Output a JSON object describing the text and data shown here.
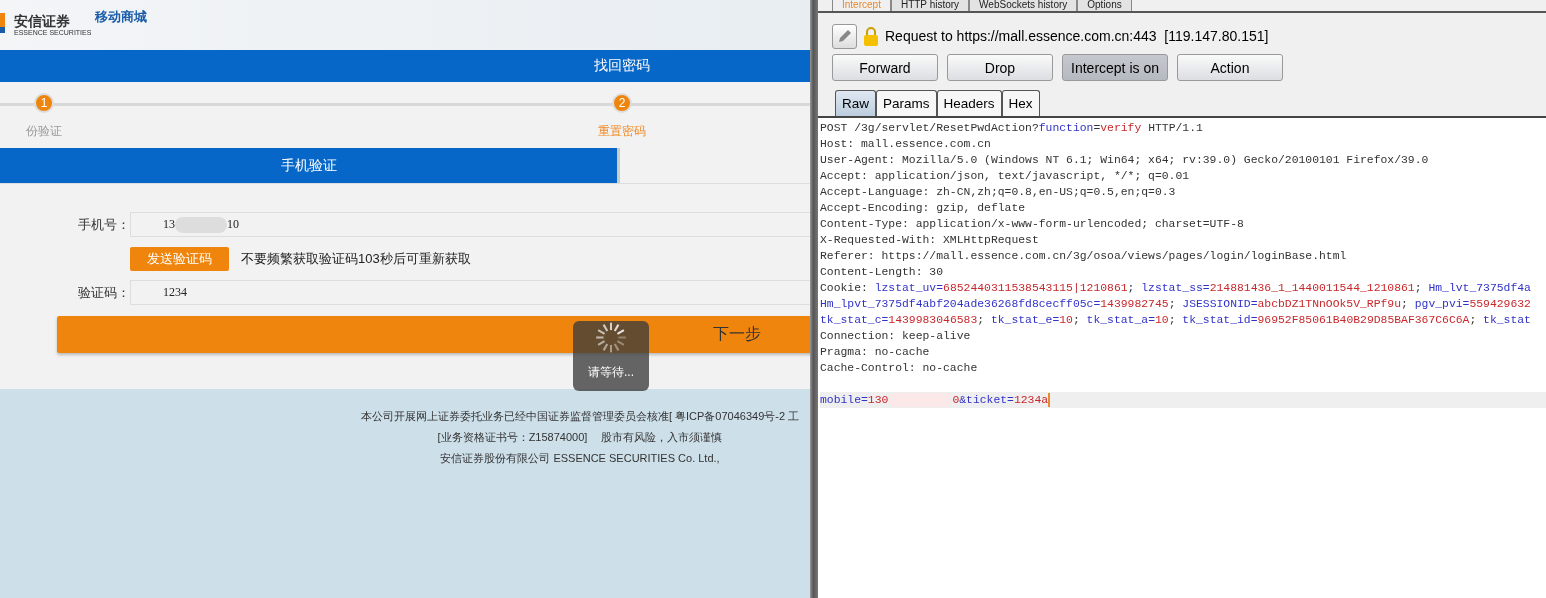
{
  "site": {
    "logo": {
      "name": "安信证券",
      "subtitle": "ESSENCE SECURITIES",
      "product": "移动商城"
    },
    "title_bar": "找回密码",
    "steps": [
      {
        "number": "1",
        "label": "份验证",
        "selected": false
      },
      {
        "number": "2",
        "label": "重置密码",
        "selected": true
      }
    ],
    "verify_tabs": [
      {
        "label": "手机验证",
        "selected": true
      },
      {
        "selected": false
      }
    ],
    "form": {
      "phone_label": "手机号：",
      "phone_prefix": "13",
      "phone_suffix": "10",
      "send_button": "发送验证码",
      "send_hint": "不要频繁获取验证码103秒后可重新获取",
      "code_label": "验证码：",
      "code_value": "1234",
      "next_button": "下一步"
    },
    "loading": {
      "text": "请等待..."
    },
    "footer": [
      "本公司开展网上证券委托业务已经中国证券监督管理委员会核准[ 粤ICP备07046349号-2 工",
      "[业务资格证书号：Z15874000]　 股市有风险，入市须谨慎",
      "安信证券股份有限公司 ESSENCE SECURITIES Co. Ltd.,"
    ]
  },
  "proxy": {
    "tabs": [
      {
        "label": "Intercept",
        "selected": true
      },
      {
        "label": "HTTP history",
        "selected": false
      },
      {
        "label": "WebSockets history",
        "selected": false
      },
      {
        "label": "Options",
        "selected": false
      }
    ],
    "request_info": "Request to https://mall.essence.com.cn:443  [119.147.80.151]",
    "buttons": [
      {
        "label": "Forward",
        "on": false
      },
      {
        "label": "Drop",
        "on": false
      },
      {
        "label": "Intercept is on",
        "on": true
      },
      {
        "label": "Action",
        "on": false
      }
    ],
    "view_tabs": [
      {
        "label": "Raw",
        "selected": true
      },
      {
        "label": "Params",
        "selected": false
      },
      {
        "label": "Headers",
        "selected": false
      },
      {
        "label": "Hex",
        "selected": false
      }
    ],
    "header_lines": [
      [
        {
          "kind": "plain",
          "text": "POST /3g/servlet/ResetPwdAction?"
        },
        {
          "kind": "key",
          "text": "function"
        },
        {
          "kind": "plain",
          "text": "="
        },
        {
          "kind": "value",
          "text": "verify"
        },
        {
          "kind": "plain",
          "text": " HTTP/1.1"
        }
      ],
      [
        {
          "kind": "plain",
          "text": "Host: mall.essence.com.cn"
        }
      ],
      [
        {
          "kind": "plain",
          "text": "User-Agent: Mozilla/5.0 (Windows NT 6.1; Win64; x64; rv:39.0) Gecko/20100101 Firefox/39.0"
        }
      ],
      [
        {
          "kind": "plain",
          "text": "Accept: application/json, text/javascript, */*; q=0.01"
        }
      ],
      [
        {
          "kind": "plain",
          "text": "Accept-Language: zh-CN,zh;q=0.8,en-US;q=0.5,en;q=0.3"
        }
      ],
      [
        {
          "kind": "plain",
          "text": "Accept-Encoding: gzip, deflate"
        }
      ],
      [
        {
          "kind": "plain",
          "text": "Content-Type: application/x-www-form-urlencoded; charset=UTF-8"
        }
      ],
      [
        {
          "kind": "plain",
          "text": "X-Requested-With: XMLHttpRequest"
        }
      ],
      [
        {
          "kind": "plain",
          "text": "Referer: https://mall.essence.com.cn/3g/osoa/views/pages/login/loginBase.html"
        }
      ],
      [
        {
          "kind": "plain",
          "text": "Content-Length: 30"
        }
      ],
      [
        {
          "kind": "plain",
          "text": "Cookie: "
        },
        {
          "kind": "key",
          "text": "lzstat_uv="
        },
        {
          "kind": "value",
          "text": "6852440311538543115|1210861"
        },
        {
          "kind": "plain",
          "text": "; "
        },
        {
          "kind": "key",
          "text": "lzstat_ss="
        },
        {
          "kind": "value",
          "text": "214881436_1_1440011544_1210861"
        },
        {
          "kind": "plain",
          "text": "; "
        },
        {
          "kind": "key",
          "text": "Hm_lvt_7375df4a"
        }
      ],
      [
        {
          "kind": "key",
          "text": "Hm_lpvt_7375df4abf204ade36268fd8cecff05c="
        },
        {
          "kind": "value",
          "text": "1439982745"
        },
        {
          "kind": "plain",
          "text": "; "
        },
        {
          "kind": "key",
          "text": "JSESSIONID="
        },
        {
          "kind": "value",
          "text": "abcbDZ1TNnOOk5V_RPf9u"
        },
        {
          "kind": "plain",
          "text": "; "
        },
        {
          "kind": "key",
          "text": "pgv_pvi="
        },
        {
          "kind": "value",
          "text": "559429632"
        }
      ],
      [
        {
          "kind": "key",
          "text": "tk_stat_c="
        },
        {
          "kind": "value",
          "text": "1439983046583"
        },
        {
          "kind": "plain",
          "text": "; "
        },
        {
          "kind": "key",
          "text": "tk_stat_e="
        },
        {
          "kind": "value",
          "text": "10"
        },
        {
          "kind": "plain",
          "text": "; "
        },
        {
          "kind": "key",
          "text": "tk_stat_a="
        },
        {
          "kind": "value",
          "text": "10"
        },
        {
          "kind": "plain",
          "text": "; "
        },
        {
          "kind": "key",
          "text": "tk_stat_id="
        },
        {
          "kind": "value",
          "text": "96952F85061B40B29D85BAF367C6C6A"
        },
        {
          "kind": "plain",
          "text": "; "
        },
        {
          "kind": "key",
          "text": "tk_stat"
        }
      ],
      [
        {
          "kind": "plain",
          "text": "Connection: keep-alive"
        }
      ],
      [
        {
          "kind": "plain",
          "text": "Pragma: no-cache"
        }
      ],
      [
        {
          "kind": "plain",
          "text": "Cache-Control: no-cache"
        }
      ]
    ],
    "body_line": {
      "highlighted": true,
      "segments": [
        {
          "kind": "key",
          "text": "mobile="
        },
        {
          "kind": "value",
          "text": "130"
        },
        {
          "kind": "mask"
        },
        {
          "kind": "value",
          "text": "0"
        },
        {
          "kind": "key",
          "text": "&ticket="
        },
        {
          "kind": "value",
          "text": "1234a"
        }
      ]
    }
  }
}
